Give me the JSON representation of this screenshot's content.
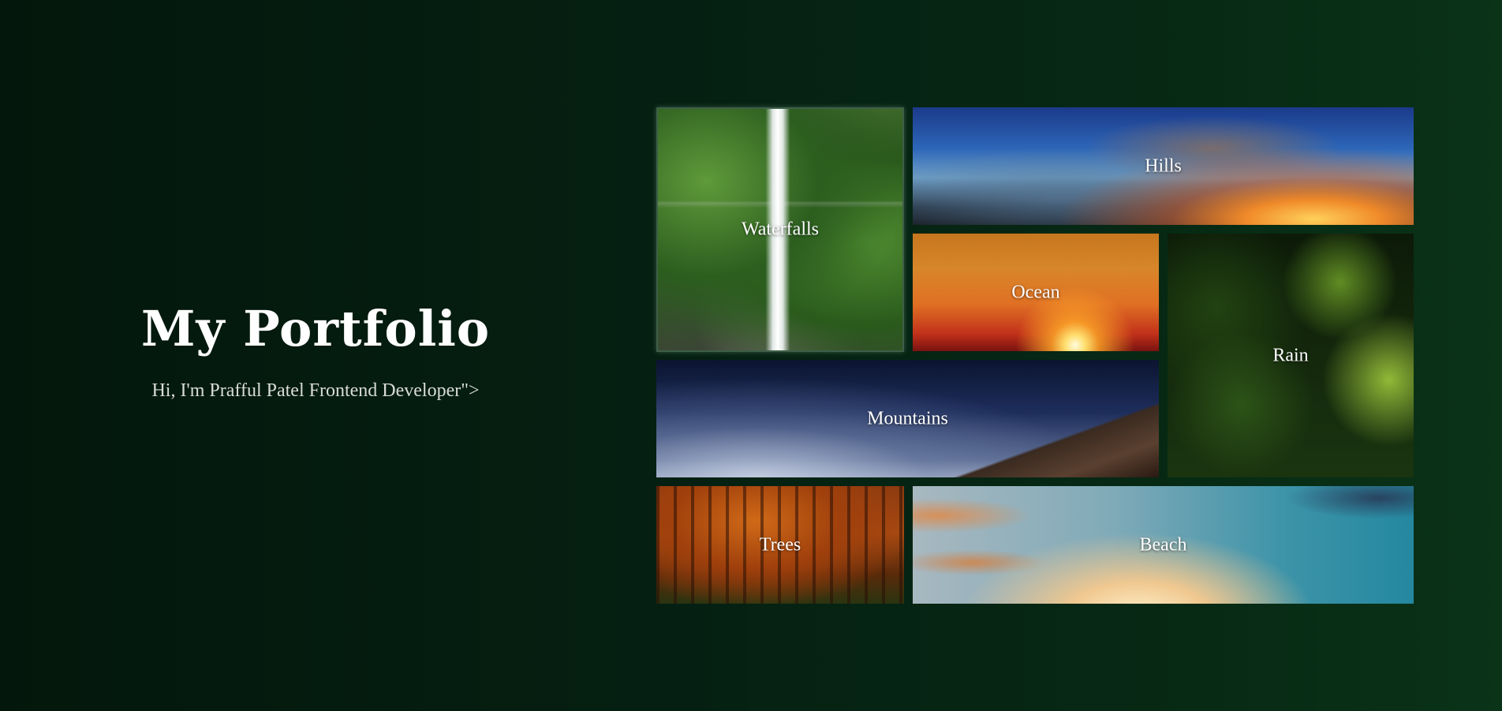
{
  "intro": {
    "title": "My Portfolio",
    "subtitle": "Hi, I'm Prafful Patel Frontend Developer\">"
  },
  "gallery": {
    "tiles": [
      {
        "label": "Waterfalls"
      },
      {
        "label": "Hills"
      },
      {
        "label": "Ocean"
      },
      {
        "label": "Rain"
      },
      {
        "label": "Mountains"
      },
      {
        "label": "Trees"
      },
      {
        "label": "Beach"
      }
    ]
  }
}
